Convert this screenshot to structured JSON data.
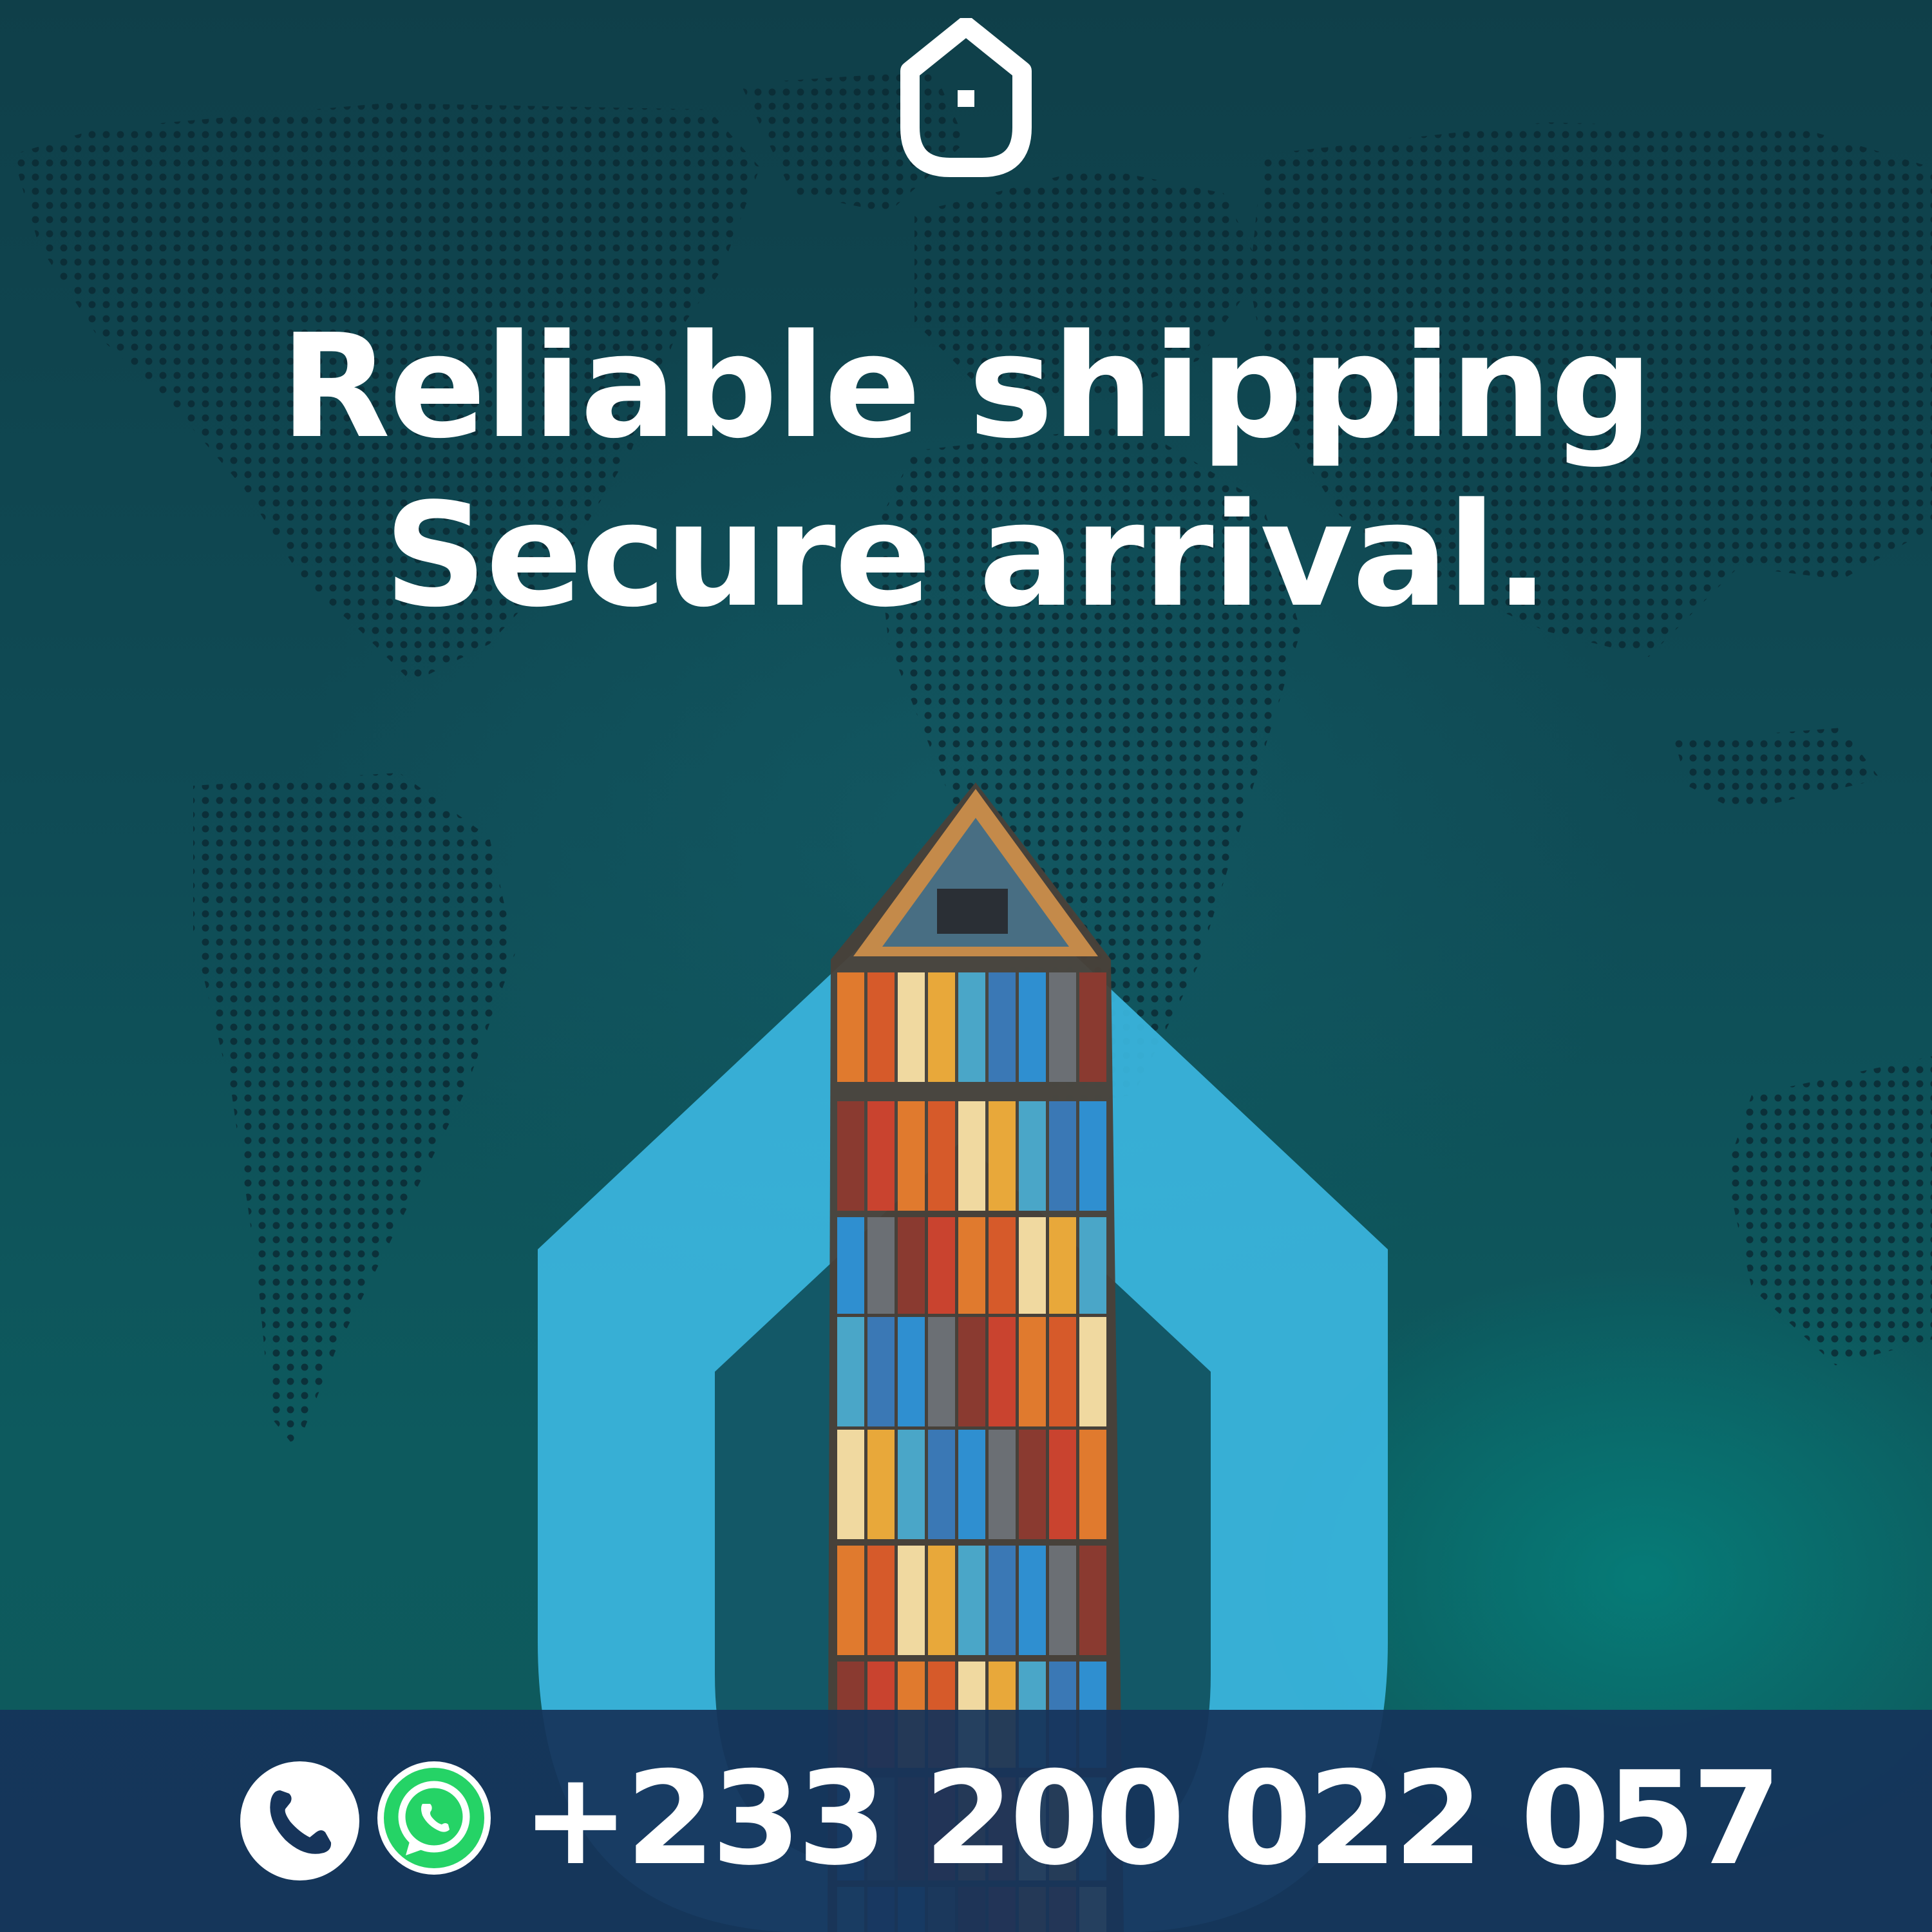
{
  "brand": {
    "logo_icon": "house-shield-logo-icon"
  },
  "headline": {
    "line1": "Reliable shipping",
    "line2": "Secure arrival."
  },
  "contact": {
    "phone_icon": "phone-icon",
    "whatsapp_icon": "whatsapp-icon",
    "number": "+233 200 022 057"
  },
  "colors": {
    "background": "#0f4a52",
    "shield": "#3bb6df",
    "contact_bar": "#16345a",
    "whatsapp": "#25d366",
    "text": "#ffffff"
  }
}
